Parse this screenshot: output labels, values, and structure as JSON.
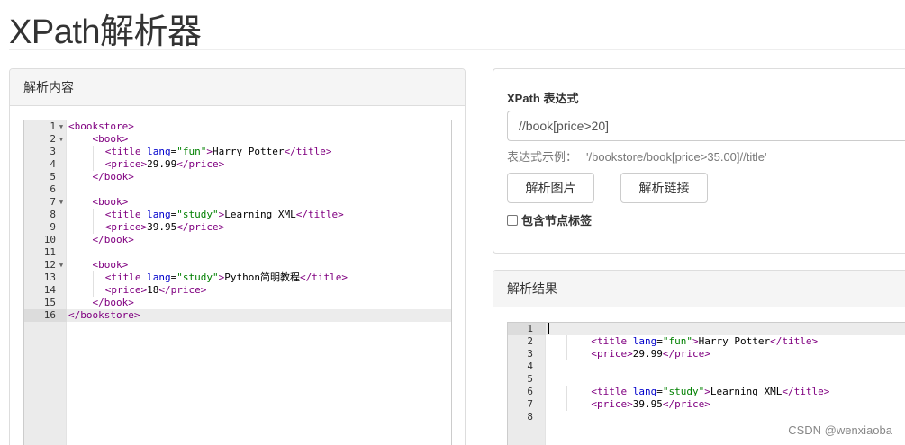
{
  "page": {
    "title": "XPath解析器"
  },
  "left_panel": {
    "heading": "解析内容",
    "lines": [
      {
        "n": "1",
        "fold": "▼"
      },
      {
        "n": "2",
        "fold": "▼"
      },
      {
        "n": "3",
        "fold": ""
      },
      {
        "n": "4",
        "fold": ""
      },
      {
        "n": "5",
        "fold": ""
      },
      {
        "n": "6",
        "fold": ""
      },
      {
        "n": "7",
        "fold": "▼"
      },
      {
        "n": "8",
        "fold": ""
      },
      {
        "n": "9",
        "fold": ""
      },
      {
        "n": "10",
        "fold": ""
      },
      {
        "n": "11",
        "fold": ""
      },
      {
        "n": "12",
        "fold": "▼"
      },
      {
        "n": "13",
        "fold": ""
      },
      {
        "n": "14",
        "fold": ""
      },
      {
        "n": "15",
        "fold": ""
      },
      {
        "n": "16",
        "fold": ""
      }
    ],
    "code": {
      "l1_tag": "<bookstore>",
      "l2_tag": "<book>",
      "l3_open": "<title",
      "l3_attr": "lang",
      "l3_eq": "=",
      "l3_val": "\"fun\"",
      "l3_close": ">",
      "l3_text": "Harry Potter",
      "l3_end": "</title>",
      "l4_open": "<price>",
      "l4_text": "29.99",
      "l4_end": "</price>",
      "l5_tag": "</book>",
      "l7_tag": "<book>",
      "l8_open": "<title",
      "l8_attr": "lang",
      "l8_eq": "=",
      "l8_val": "\"study\"",
      "l8_close": ">",
      "l8_text": "Learning XML",
      "l8_end": "</title>",
      "l9_open": "<price>",
      "l9_text": "39.95",
      "l9_end": "</price>",
      "l10_tag": "</book>",
      "l12_tag": "<book>",
      "l13_open": "<title",
      "l13_attr": "lang",
      "l13_eq": "=",
      "l13_val": "\"study\"",
      "l13_close": ">",
      "l13_text": "Python简明教程",
      "l13_end": "</title>",
      "l14_open": "<price>",
      "l14_text": "18",
      "l14_end": "</price>",
      "l15_tag": "</book>",
      "l16_tag": "</bookstore>"
    }
  },
  "expression_panel": {
    "label": "XPath 表达式",
    "input_value": "//book[price>20]",
    "example_label": "表达式示例：",
    "example_value": "'/bookstore/book[price>35.00]//title'",
    "button_image": "解析图片",
    "button_link": "解析链接",
    "checkbox_label": "包含节点标签"
  },
  "result_panel": {
    "heading": "解析结果",
    "lines": [
      "1",
      "2",
      "3",
      "4",
      "5",
      "6",
      "7",
      "8"
    ],
    "code": {
      "r2_open": "<title",
      "r2_attr": "lang",
      "r2_eq": "=",
      "r2_val": "\"fun\"",
      "r2_close": ">",
      "r2_text": "Harry Potter",
      "r2_end": "</title>",
      "r3_open": "<price>",
      "r3_text": "29.99",
      "r3_end": "</price>",
      "r6_open": "<title",
      "r6_attr": "lang",
      "r6_eq": "=",
      "r6_val": "\"study\"",
      "r6_close": ">",
      "r6_text": "Learning XML",
      "r6_end": "</title>",
      "r7_open": "<price>",
      "r7_text": "39.95",
      "r7_end": "</price>"
    }
  },
  "watermark": "CSDN @wenxiaoba"
}
